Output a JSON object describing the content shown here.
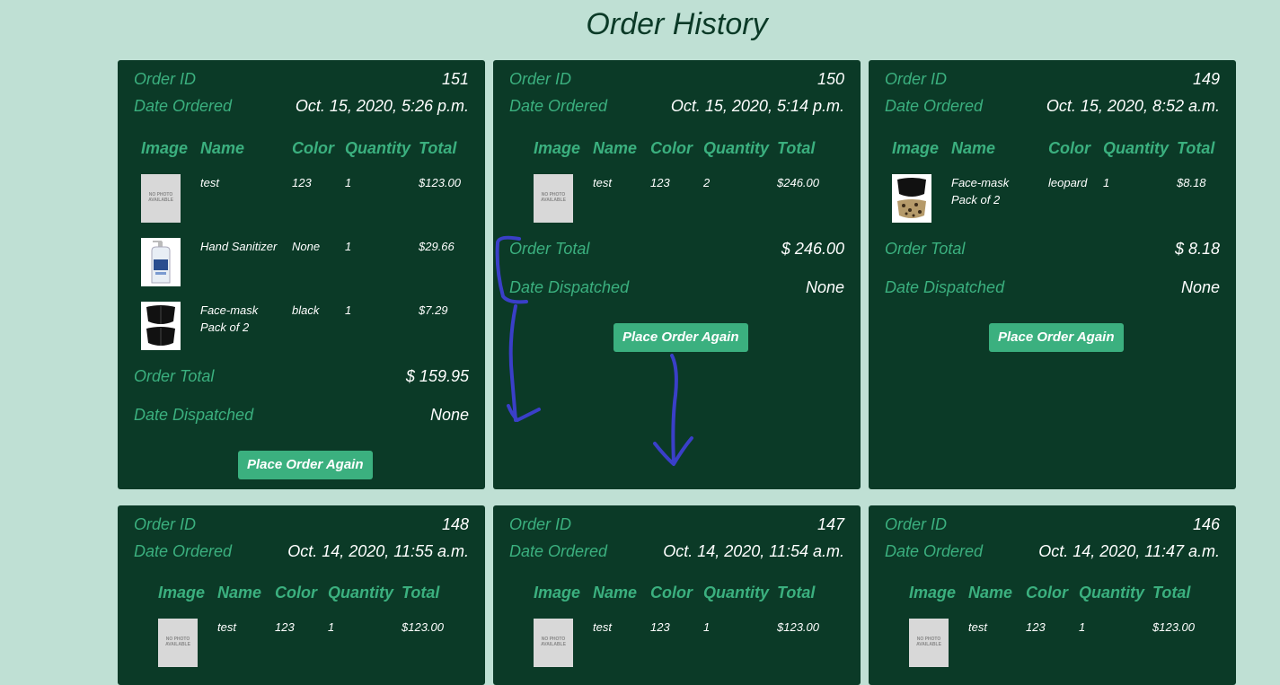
{
  "page": {
    "title": "Order History"
  },
  "labels": {
    "order_id": "Order ID",
    "date_ordered": "Date Ordered",
    "order_total": "Order Total",
    "date_dispatched": "Date Dispatched",
    "col_image": "Image",
    "col_name": "Name",
    "col_color": "Color",
    "col_quantity": "Quantity",
    "col_total": "Total",
    "no_photo": "NO PHOTO AVAILABLE",
    "place_order_again": "Place Order Again"
  },
  "orders": [
    {
      "id": "151",
      "date": "Oct. 15, 2020, 5:26 p.m.",
      "items": [
        {
          "image": "no-photo",
          "name": "test",
          "color": "123",
          "qty": "1",
          "total": "$123.00"
        },
        {
          "image": "hand-sanitizer",
          "name": "Hand Sanitizer",
          "color": "None",
          "qty": "1",
          "total": "$29.66"
        },
        {
          "image": "face-mask-black",
          "name": "Face-mask Pack of 2",
          "color": "black",
          "qty": "1",
          "total": "$7.29"
        }
      ],
      "order_total": "$ 159.95",
      "dispatched": "None"
    },
    {
      "id": "150",
      "date": "Oct. 15, 2020, 5:14 p.m.",
      "items": [
        {
          "image": "no-photo",
          "name": "test",
          "color": "123",
          "qty": "2",
          "total": "$246.00"
        }
      ],
      "order_total": "$ 246.00",
      "dispatched": "None"
    },
    {
      "id": "149",
      "date": "Oct. 15, 2020, 8:52 a.m.",
      "items": [
        {
          "image": "face-mask-leopard",
          "name": "Face-mask Pack of 2",
          "color": "leopard",
          "qty": "1",
          "total": "$8.18"
        }
      ],
      "order_total": "$ 8.18",
      "dispatched": "None"
    },
    {
      "id": "148",
      "date": "Oct. 14, 2020, 11:55 a.m.",
      "items": [
        {
          "image": "no-photo",
          "name": "test",
          "color": "123",
          "qty": "1",
          "total": "$123.00"
        }
      ]
    },
    {
      "id": "147",
      "date": "Oct. 14, 2020, 11:54 a.m.",
      "items": [
        {
          "image": "no-photo",
          "name": "test",
          "color": "123",
          "qty": "1",
          "total": "$123.00"
        }
      ]
    },
    {
      "id": "146",
      "date": "Oct. 14, 2020, 11:47 a.m.",
      "items": [
        {
          "image": "no-photo",
          "name": "test",
          "color": "123",
          "qty": "1",
          "total": "$123.00"
        }
      ]
    }
  ],
  "colors": {
    "background": "#bfe0d4",
    "card": "#0b3a27",
    "accent": "#3bb07f",
    "annotation": "#3a3fc8"
  }
}
